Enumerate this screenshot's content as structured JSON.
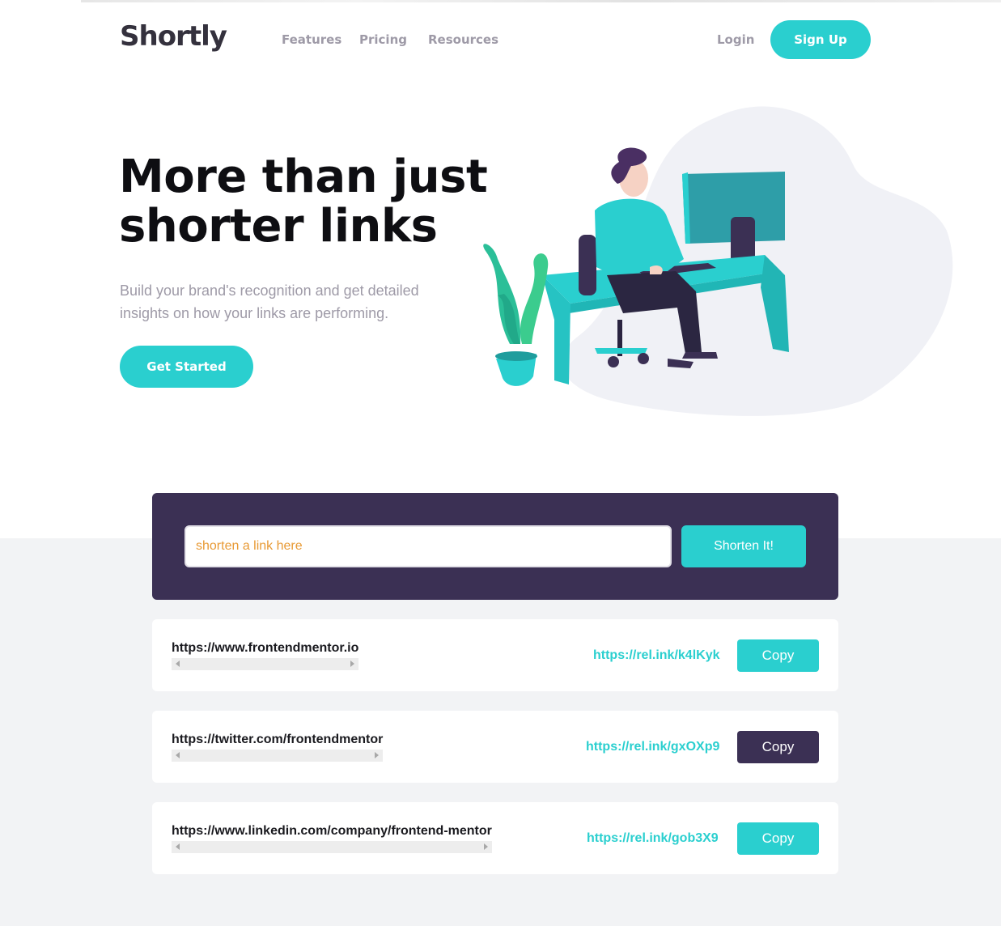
{
  "nav": {
    "logo": "Shortly",
    "links": [
      "Features",
      "Pricing",
      "Resources"
    ],
    "login": "Login",
    "signup": "Sign Up"
  },
  "hero": {
    "title": "More than just shorter links",
    "subtitle": "Build your brand's recognition and get detailed insights on how your links are performing.",
    "cta": "Get Started"
  },
  "shorten": {
    "placeholder": "shorten a link here",
    "button": "Shorten It!"
  },
  "results": [
    {
      "original": "https://www.frontendmentor.io",
      "short": "https://rel.ink/k4lKyk",
      "copy_label": "Copy",
      "copied": false
    },
    {
      "original": "https://twitter.com/frontendmentor",
      "short": "https://rel.ink/gxOXp9",
      "copy_label": "Copy",
      "copied": true
    },
    {
      "original": "https://www.linkedin.com/company/frontend-mentor",
      "short": "https://rel.ink/gob3X9",
      "copy_label": "Copy",
      "copied": false
    }
  ],
  "colors": {
    "cyan": "#2acfcf",
    "dark_violet": "#3b3054",
    "grayish_violet": "#9e9aa7",
    "background_gray": "#f2f3f5"
  }
}
